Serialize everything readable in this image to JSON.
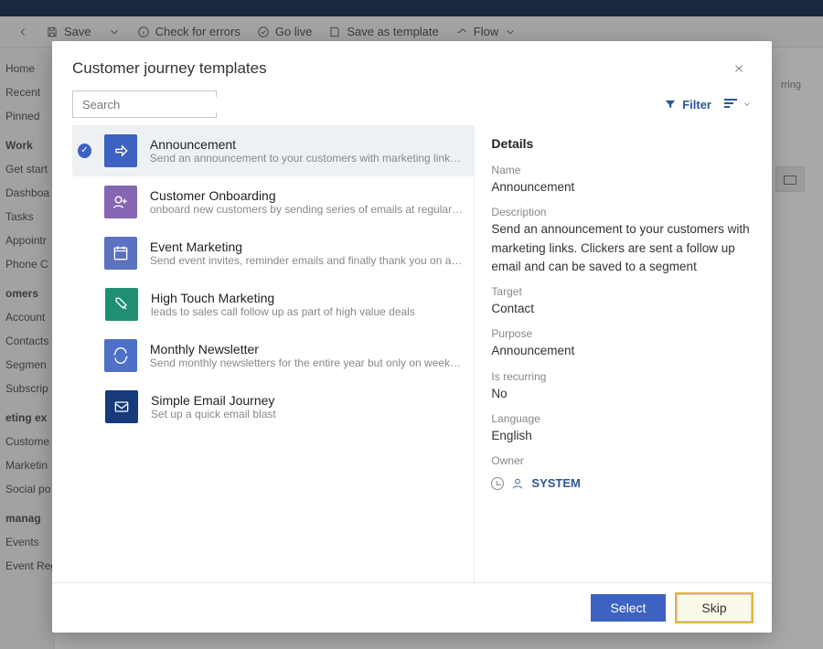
{
  "toolbar": {
    "save": "Save",
    "check": "Check for errors",
    "go_live": "Go live",
    "save_as": "Save as template",
    "flow": "Flow"
  },
  "sidebar": {
    "items": [
      "Home",
      "Recent",
      "Pinned",
      "Work",
      "Get start",
      "Dashboa",
      "Tasks",
      "Appointr",
      "Phone C",
      "omers",
      "Account",
      "Contacts",
      "Segmen",
      "Subscrip",
      "eting ex",
      "Custome",
      "Marketin",
      "Social po",
      " manag",
      "Events",
      "Event Registrations"
    ]
  },
  "modal": {
    "title": "Customer journey templates",
    "search_placeholder": "Search",
    "filter_label": "Filter",
    "details_heading": "Details",
    "footer": {
      "select": "Select",
      "skip": "Skip"
    },
    "templates": [
      {
        "title": "Announcement",
        "desc": "Send an announcement to your customers with marketing links. Clickers are sent a…",
        "selected": true
      },
      {
        "title": "Customer Onboarding",
        "desc": "onboard new customers by sending series of emails at regular cadence",
        "selected": false
      },
      {
        "title": "Event Marketing",
        "desc": "Send event invites, reminder emails and finally thank you on attending",
        "selected": false
      },
      {
        "title": "High Touch Marketing",
        "desc": "leads to sales call follow up as part of high value deals",
        "selected": false
      },
      {
        "title": "Monthly Newsletter",
        "desc": "Send monthly newsletters for the entire year but only on weekday afternoons",
        "selected": false
      },
      {
        "title": "Simple Email Journey",
        "desc": "Set up a quick email blast",
        "selected": false
      }
    ],
    "details": {
      "name_label": "Name",
      "name": "Announcement",
      "description_label": "Description",
      "description": "Send an announcement to your customers with marketing links. Clickers are sent a follow up email and can be saved to a segment",
      "target_label": "Target",
      "target": "Contact",
      "purpose_label": "Purpose",
      "purpose": "Announcement",
      "recurring_label": "Is recurring",
      "recurring": "No",
      "language_label": "Language",
      "language": "English",
      "owner_label": "Owner",
      "owner_name": "SYSTEM"
    }
  },
  "bg_main": {
    "recurring": "rring"
  }
}
